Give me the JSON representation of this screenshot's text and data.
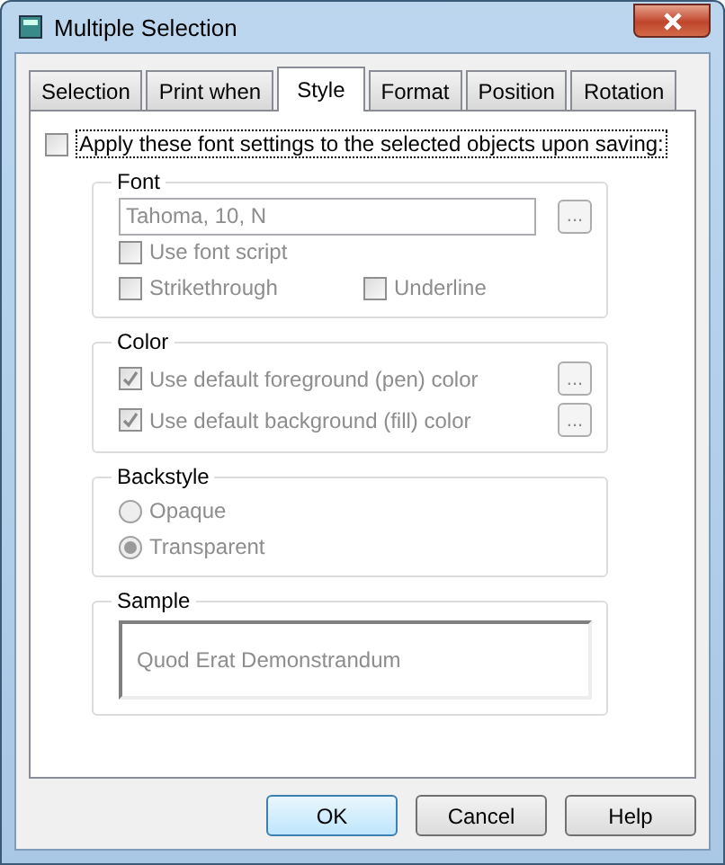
{
  "window": {
    "title": "Multiple Selection"
  },
  "tabs": [
    {
      "label": "Selection",
      "selected": false
    },
    {
      "label": "Print when",
      "selected": false
    },
    {
      "label": "Style",
      "selected": true
    },
    {
      "label": "Format",
      "selected": false
    },
    {
      "label": "Position",
      "selected": false
    },
    {
      "label": "Rotation",
      "selected": false
    }
  ],
  "apply": {
    "label": "Apply these font settings to the selected objects upon saving:",
    "checked": false
  },
  "font": {
    "title": "Font",
    "field_value": "Tahoma, 10, N",
    "disabled": true,
    "button": "...",
    "options": [
      {
        "label": "Use font script",
        "checked": false
      },
      {
        "label": "Strikethrough",
        "checked": false
      },
      {
        "label": "Underline",
        "checked": false
      }
    ]
  },
  "color": {
    "title": "Color",
    "disabled": true,
    "options": [
      {
        "label": "Use default foreground (pen) color",
        "checked": true,
        "button": "..."
      },
      {
        "label": "Use default background (fill) color",
        "checked": true,
        "button": "..."
      }
    ]
  },
  "backstyle": {
    "title": "Backstyle",
    "disabled": true,
    "options": [
      {
        "label": "Opaque",
        "selected": false
      },
      {
        "label": "Transparent",
        "selected": true
      }
    ]
  },
  "sample": {
    "title": "Sample",
    "text": "Quod Erat Demonstrandum"
  },
  "buttons": [
    {
      "label": "OK",
      "default": true
    },
    {
      "label": "Cancel",
      "default": false
    },
    {
      "label": "Help",
      "default": false
    }
  ]
}
